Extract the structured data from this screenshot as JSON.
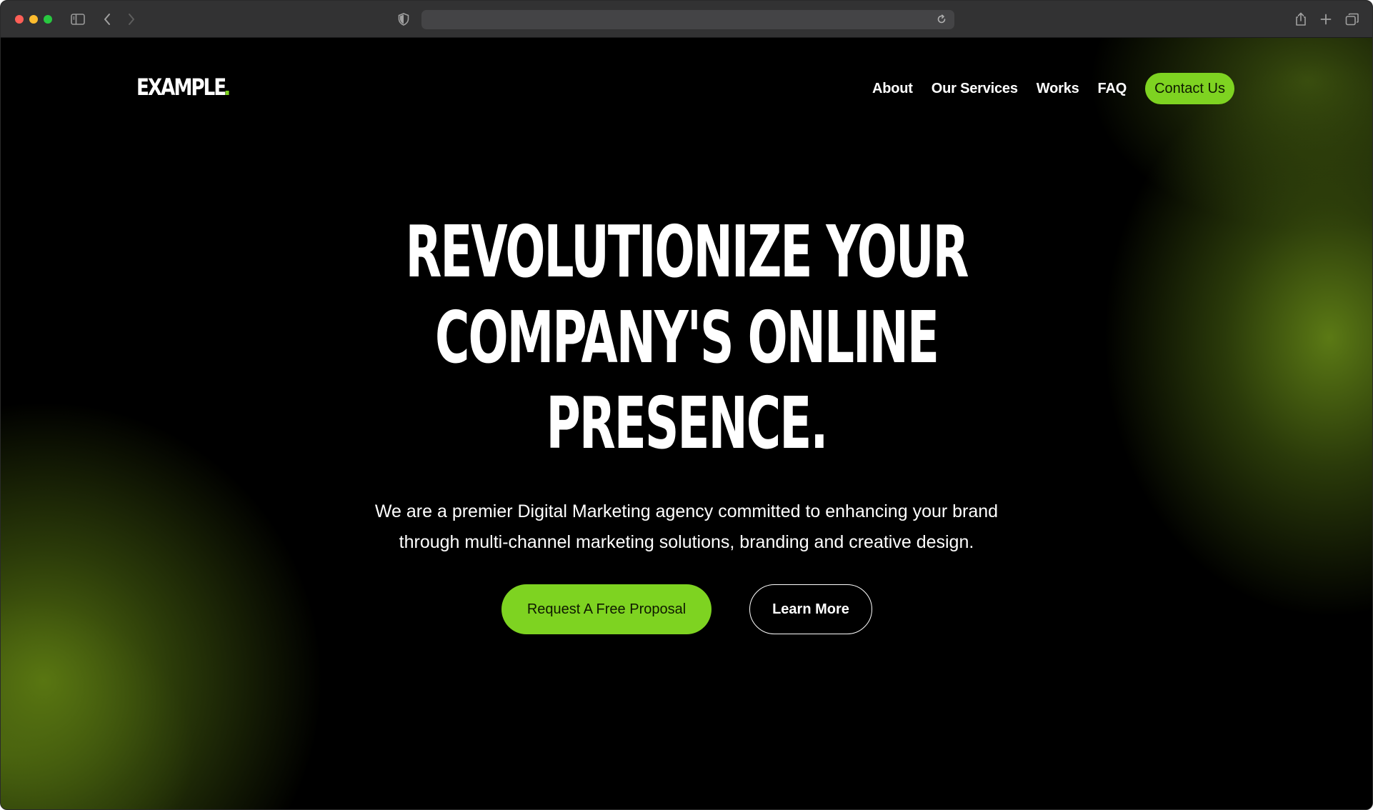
{
  "browser": {
    "address_value": "",
    "icons": [
      "sidebar-icon",
      "back-icon",
      "forward-icon",
      "shield-icon",
      "reload-icon",
      "share-icon",
      "new-tab-icon",
      "tab-overview-icon"
    ]
  },
  "site": {
    "logo": "EXAMPLE",
    "nav": {
      "items": [
        {
          "label": "About"
        },
        {
          "label": "Our Services"
        },
        {
          "label": "Works"
        },
        {
          "label": "FAQ"
        }
      ],
      "cta": "Contact Us"
    },
    "hero": {
      "title_lines": [
        "REVOLUTIONIZE YOUR",
        "COMPANY'S ONLINE",
        "PRESENCE."
      ],
      "subtitle_lines": [
        "We are a premier Digital Marketing agency committed to enhancing your brand",
        "through multi-channel marketing solutions, branding and creative design."
      ],
      "primary_button": "Request A Free Proposal",
      "secondary_button": "Learn More"
    }
  },
  "colors": {
    "accent": "#7ed321",
    "background": "#000000",
    "text": "#ffffff",
    "chrome": "#323233"
  }
}
